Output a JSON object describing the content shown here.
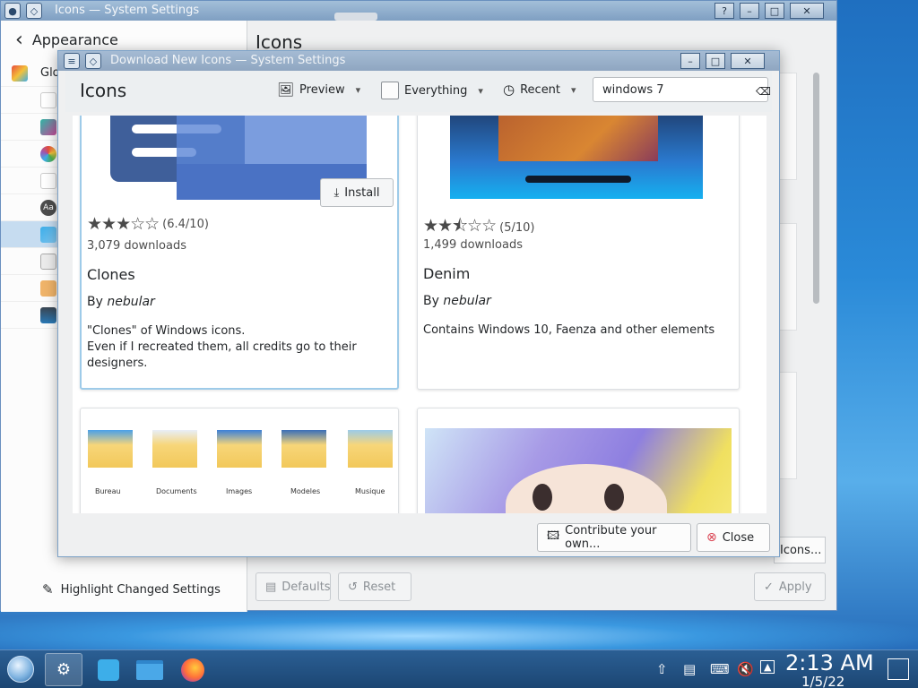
{
  "colors": {
    "accent": "#3daee9",
    "selection": "#c6dcf0",
    "window_bg": "#eff0f1",
    "taskbar": "#2b5f94",
    "close_red": "#da4453"
  },
  "main_window": {
    "title": "Icons — System Settings",
    "back_label": "Appearance",
    "page_title": "Icons",
    "sidebar_partial_label": "Glo",
    "highlight_changed": "Highlight Changed Settings",
    "defaults_label": "Defaults",
    "reset_label": "Reset",
    "apply_label": "Apply",
    "get_new_icons_partial": "Icons..."
  },
  "dialog": {
    "title": "Download New Icons — System Settings",
    "heading": "Icons",
    "view_mode_label": "Preview",
    "filter_label": "Everything",
    "sort_label": "Recent",
    "search_value": "windows 7",
    "contribute_label": "Contribute your own...",
    "close_label": "Close",
    "install_label": "Install",
    "items": [
      {
        "rating_value": 6.4,
        "rating_text": "(6.4/10)",
        "downloads": "3,079 downloads",
        "name": "Clones",
        "author_prefix": "By",
        "author": "nebular",
        "description_lines": [
          "\"Clones\" of Windows icons.",
          "Even if I recreated them, all credits go to their",
          "designers."
        ]
      },
      {
        "rating_value": 5,
        "rating_text": "(5/10)",
        "downloads": "1,499 downloads",
        "name": "Denim",
        "author_prefix": "By",
        "author": "nebular",
        "description_lines": [
          "Contains Windows 10, Faenza and other elements"
        ]
      }
    ],
    "folder_preview_labels": [
      "Bureau",
      "Documents",
      "Images",
      "Modeles",
      "Musique"
    ]
  },
  "taskbar": {
    "time": "2:13 AM",
    "date": "1/5/22"
  }
}
